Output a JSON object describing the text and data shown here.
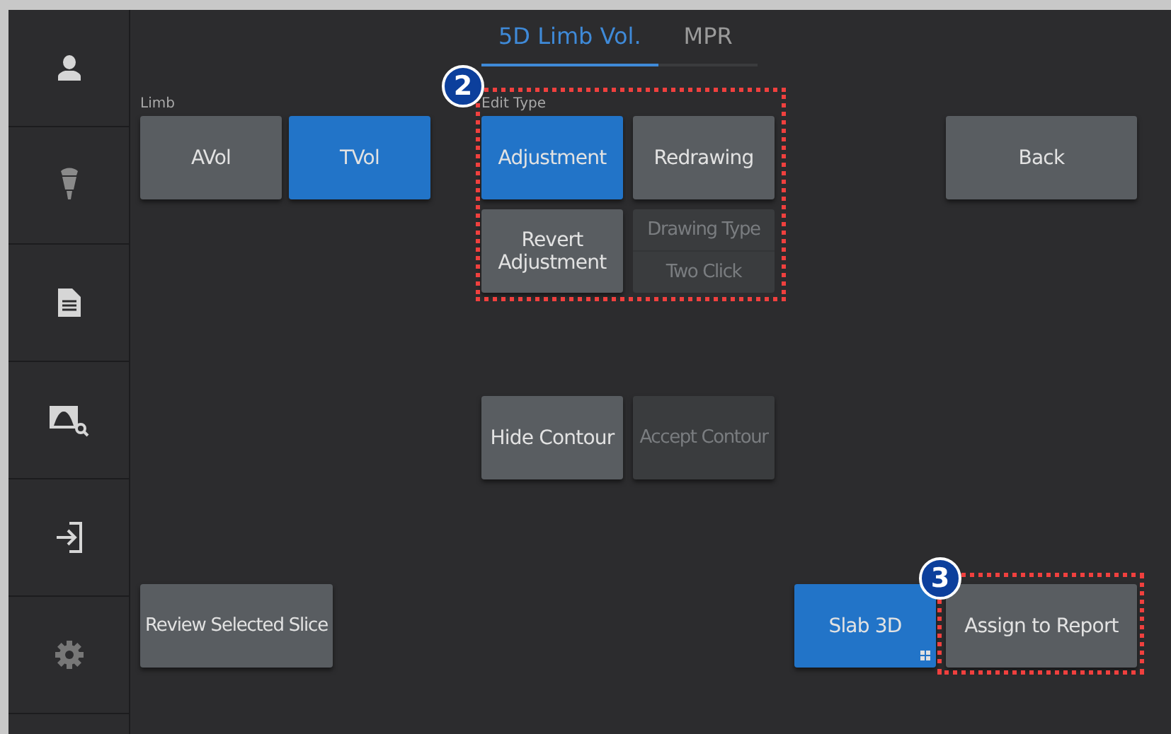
{
  "sidebar": {
    "items": [
      {
        "kind": "person"
      },
      {
        "kind": "probe"
      },
      {
        "kind": "document"
      },
      {
        "kind": "image-search"
      },
      {
        "kind": "exit"
      },
      {
        "kind": "settings"
      }
    ]
  },
  "tabs": [
    {
      "label": "5D Limb Vol.",
      "selected": true
    },
    {
      "label": "MPR",
      "selected": false
    }
  ],
  "limb": {
    "label": "Limb",
    "options": [
      {
        "label": "AVol",
        "selected": false
      },
      {
        "label": "TVol",
        "selected": true
      }
    ]
  },
  "edit_type": {
    "label": "Edit Type",
    "options": [
      {
        "label": "Adjustment",
        "selected": true
      },
      {
        "label": "Redrawing",
        "selected": false
      }
    ],
    "revert_button": {
      "label": "Revert Adjustment",
      "disabled": false
    },
    "drawing_type": {
      "label": "Drawing Type",
      "value": "Two Click",
      "disabled": true
    },
    "badge": "2"
  },
  "back_button": {
    "label": "Back",
    "disabled": false
  },
  "hide_contour_button": {
    "label": "Hide Contour",
    "disabled": false
  },
  "accept_contour_button": {
    "label": "Accept Contour",
    "disabled": true
  },
  "review_button": {
    "label": "Review Selected Slice",
    "disabled": false
  },
  "slab_button": {
    "label": "Slab 3D",
    "selected": true
  },
  "assign_button": {
    "label": "Assign to Report",
    "disabled": false,
    "badge": "3"
  }
}
